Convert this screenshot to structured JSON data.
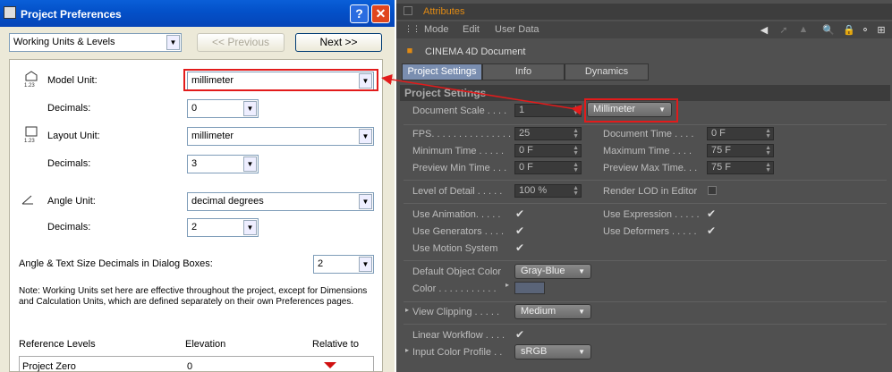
{
  "dialog": {
    "title": "Project Preferences",
    "help_glyph": "?",
    "close_glyph": "✕",
    "category": "Working Units & Levels",
    "prev_label": "<< Previous",
    "next_label": "Next >>",
    "model_unit_label": "Model Unit:",
    "model_unit": "millimeter",
    "decimals_label": "Decimals:",
    "model_decimals": "0",
    "layout_unit_label": "Layout Unit:",
    "layout_unit": "millimeter",
    "layout_decimals": "3",
    "angle_unit_label": "Angle Unit:",
    "angle_unit": "decimal degrees",
    "angle_decimals": "2",
    "angle_text_label": "Angle & Text Size Decimals in Dialog Boxes:",
    "angle_text_decimals": "2",
    "note": "Note: Working Units set here are effective throughout the project, except for Dimensions and Calculation Units, which are defined separately on their own Preferences pages.",
    "ref_header": "Reference Levels",
    "elev_header": "Elevation",
    "rel_header": "Relative to",
    "row_name": "Project Zero",
    "row_elev": "0",
    "icon_text": "1.23"
  },
  "attr": {
    "title": "Attributes",
    "menu": [
      "Mode",
      "Edit",
      "User Data"
    ],
    "doc": "CINEMA 4D Document",
    "tabs": [
      "Project Settings",
      "Info",
      "Dynamics"
    ],
    "section": "Project Settings",
    "doc_scale_label": "Document Scale . . . .",
    "doc_scale": "1",
    "scale_unit": "Millimeter",
    "fps_label": "FPS. . . . . . . . . . . . . . .",
    "fps": "25",
    "doc_time_label": "Document Time . . . .",
    "doc_time": "0 F",
    "min_time_label": "Minimum Time . . . . .",
    "min_time": "0 F",
    "max_time_label": "Maximum Time . . . .",
    "max_time": "75 F",
    "prev_min_label": "Preview Min Time . . .",
    "prev_min": "0 F",
    "prev_max_label": "Preview Max Time. . .",
    "prev_max": "75 F",
    "lod_label": "Level of Detail . . . . .",
    "lod": "100 %",
    "render_lod_label": "Render LOD in Editor",
    "use_anim_label": "Use Animation. . . . .",
    "use_expr_label": "Use Expression . . . . .",
    "use_gen_label": "Use Generators . . . .",
    "use_def_label": "Use Deformers . . . . .",
    "use_motion_label": "Use Motion System",
    "def_color_label": "Default Object Color",
    "def_color": "Gray-Blue",
    "color_label": "Color . . . . . . . . . . .",
    "clip_label": "View Clipping . . . . .",
    "clip": "Medium",
    "lin_label": "Linear Workflow . . . .",
    "icp_label": "Input Color Profile . .",
    "icp": "sRGB",
    "check": "✔",
    "arrow_glyph": "▸"
  },
  "colors": {
    "highlight": "#e21b1b",
    "accent": "#e08a14"
  }
}
